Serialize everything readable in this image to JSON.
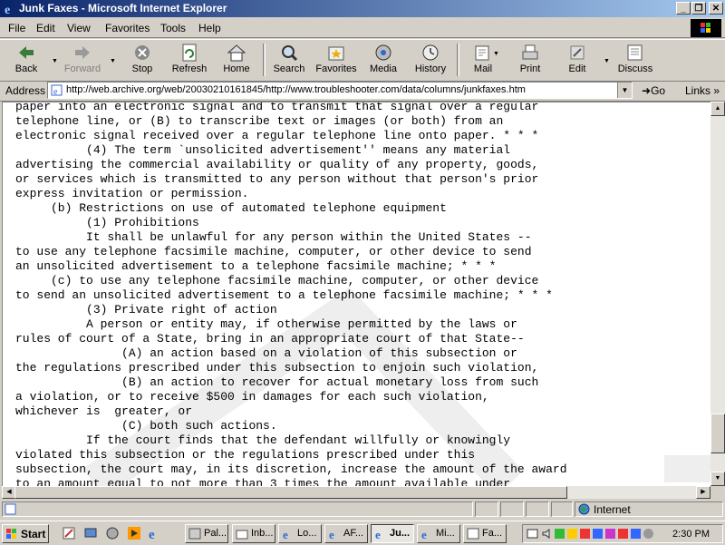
{
  "window": {
    "title": "Junk Faxes - Microsoft Internet Explorer"
  },
  "window_controls": {
    "minimize": "_",
    "maximize": "❐",
    "close": "✕"
  },
  "menu": [
    "File",
    "Edit",
    "View",
    "Favorites",
    "Tools",
    "Help"
  ],
  "toolbar": {
    "back": "Back",
    "forward": "Forward",
    "stop": "Stop",
    "refresh": "Refresh",
    "home": "Home",
    "search": "Search",
    "favorites": "Favorites",
    "media": "Media",
    "history": "History",
    "mail": "Mail",
    "print": "Print",
    "edit": "Edit",
    "discuss": "Discuss"
  },
  "address": {
    "label": "Address",
    "url": "http://web.archive.org/web/20030210161845/http://www.troubleshooter.com/data/columns/junkfaxes.htm",
    "go": "Go",
    "links": "Links"
  },
  "content": {
    "lines": [
      "paper into an electronic signal and to transmit that signal over a regular",
      "telephone line, or (B) to transcribe text or images (or both) from an",
      "electronic signal received over a regular telephone line onto paper. * * *",
      "          (4) The term `unsolicited advertisement'' means any material",
      "advertising the commercial availability or quality of any property, goods,",
      "or services which is transmitted to any person without that person's prior",
      "express invitation or permission.",
      "     (b) Restrictions on use of automated telephone equipment",
      "          (1) Prohibitions",
      "          It shall be unlawful for any person within the United States --",
      "to use any telephone facsimile machine, computer, or other device to send",
      "an unsolicited advertisement to a telephone facsimile machine; * * *",
      "     (c) to use any telephone facsimile machine, computer, or other device",
      "to send an unsolicited advertisement to a telephone facsimile machine; * * *",
      "          (3) Private right of action",
      "          A person or entity may, if otherwise permitted by the laws or",
      "rules of court of a State, bring in an appropriate court of that State--",
      "               (A) an action based on a violation of this subsection or",
      "the regulations prescribed under this subsection to enjoin such violation,",
      "               (B) an action to recover for actual monetary loss from such",
      "a violation, or to receive $500 in damages for each such violation,",
      "whichever is  greater, or",
      "               (C) both such actions.",
      "          If the court finds that the defendant willfully or knowingly",
      "violated this subsection or the regulations prescribed under this",
      "subsection, the court may, in its discretion, increase the amount of the award",
      "to an amount equal to not more than 3 times the amount available under"
    ]
  },
  "status": {
    "zone": "Internet"
  },
  "taskbar": {
    "start": "Start",
    "tasks": [
      "Pal...",
      "Inb...",
      "Lo...",
      "AF...",
      "Ju...",
      "Mi...",
      "Fa..."
    ],
    "clock": "2:30 PM"
  },
  "colors": {
    "title_active": "#0a246a",
    "title_gradient_end": "#a6caf0",
    "chrome": "#d4d0c8"
  }
}
